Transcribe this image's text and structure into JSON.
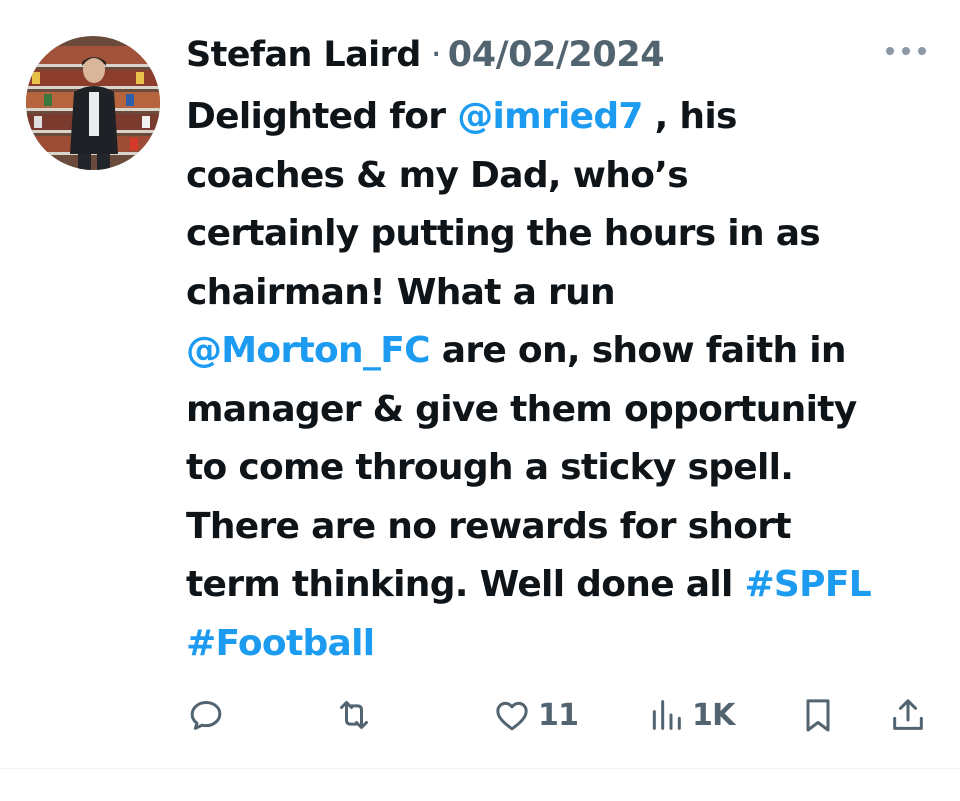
{
  "tweet": {
    "author_name": "Stefan Laird",
    "separator": "·",
    "date": "04/02/2024",
    "body_lines": [
      [
        {
          "t": "Delighted for "
        },
        {
          "t": "@imried7",
          "link": true
        },
        {
          "t": " , his"
        }
      ],
      [
        {
          "t": "coaches & my Dad, who’s"
        }
      ],
      [
        {
          "t": "certainly putting the hours in as"
        }
      ],
      [
        {
          "t": "chairman! What a run"
        }
      ],
      [
        {
          "t": "@Morton_FC",
          "link": true
        },
        {
          "t": " are on, show faith in"
        }
      ],
      [
        {
          "t": "manager & give them opportunity"
        }
      ],
      [
        {
          "t": "to come through a sticky spell."
        }
      ],
      [
        {
          "t": "There are no rewards for short"
        }
      ],
      [
        {
          "t": "term thinking. Well done all "
        },
        {
          "t": "#SPFL",
          "link": true
        }
      ],
      [
        {
          "t": "#Football",
          "link": true
        }
      ]
    ],
    "stats": {
      "replies": "",
      "reposts": "",
      "likes": "11",
      "views": "1K"
    },
    "icons": {
      "more": "more-horizontal-icon",
      "reply": "reply-icon",
      "repost": "repost-icon",
      "like": "heart-icon",
      "views": "views-chart-icon",
      "bookmark": "bookmark-icon",
      "share": "share-icon"
    },
    "colors": {
      "text": "#0f1419",
      "muted": "#536471",
      "link": "#1d9bf0",
      "background": "#ffffff"
    }
  }
}
